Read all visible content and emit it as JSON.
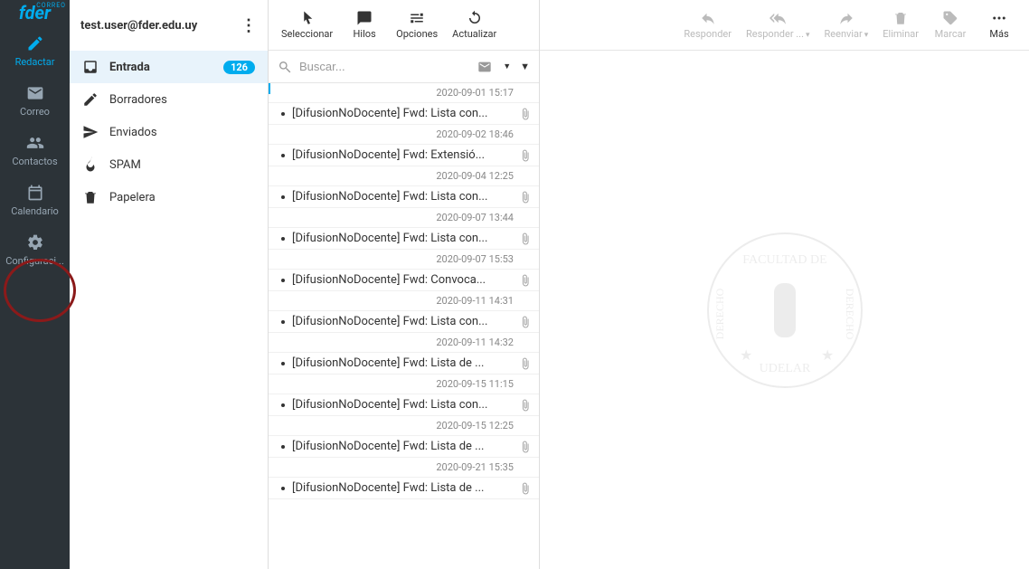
{
  "logo": {
    "text": "fder",
    "tag": "CORREO"
  },
  "sidebar": {
    "items": [
      {
        "label": "Redactar"
      },
      {
        "label": "Correo"
      },
      {
        "label": "Contactos"
      },
      {
        "label": "Calendario"
      },
      {
        "label": "Configuraci..."
      }
    ]
  },
  "user": {
    "email": "test.user@fder.edu.uy"
  },
  "folders": [
    {
      "label": "Entrada",
      "count": "126"
    },
    {
      "label": "Borradores"
    },
    {
      "label": "Enviados"
    },
    {
      "label": "SPAM"
    },
    {
      "label": "Papelera"
    }
  ],
  "msg_toolbar": [
    {
      "label": "Seleccionar"
    },
    {
      "label": "Hilos"
    },
    {
      "label": "Opciones"
    },
    {
      "label": "Actualizar"
    }
  ],
  "search": {
    "placeholder": "Buscar..."
  },
  "preview_toolbar": [
    {
      "label": "Responder"
    },
    {
      "label": "Responder ..."
    },
    {
      "label": "Reenviar"
    },
    {
      "label": "Eliminar"
    },
    {
      "label": "Marcar"
    },
    {
      "label": "Más"
    }
  ],
  "messages": [
    {
      "date": "2020-09-01 15:17",
      "subject": "[DifusionNoDocente] Fwd: Lista con..."
    },
    {
      "date": "2020-09-02 18:46",
      "subject": "[DifusionNoDocente] Fwd: Extensió..."
    },
    {
      "date": "2020-09-04 12:25",
      "subject": "[DifusionNoDocente] Fwd: Lista con..."
    },
    {
      "date": "2020-09-07 13:44",
      "subject": "[DifusionNoDocente] Fwd: Lista con..."
    },
    {
      "date": "2020-09-07 15:53",
      "subject": "[DifusionNoDocente] Fwd: Convoca..."
    },
    {
      "date": "2020-09-11 14:31",
      "subject": "[DifusionNoDocente] Fwd: Lista con..."
    },
    {
      "date": "2020-09-11 14:32",
      "subject": "[DifusionNoDocente] Fwd: Lista de ..."
    },
    {
      "date": "2020-09-15 11:15",
      "subject": "[DifusionNoDocente] Fwd: Lista con..."
    },
    {
      "date": "2020-09-15 12:25",
      "subject": "[DifusionNoDocente] Fwd: Lista de ..."
    },
    {
      "date": "2020-09-21 15:35",
      "subject": "[DifusionNoDocente] Fwd: Lista de ..."
    }
  ]
}
